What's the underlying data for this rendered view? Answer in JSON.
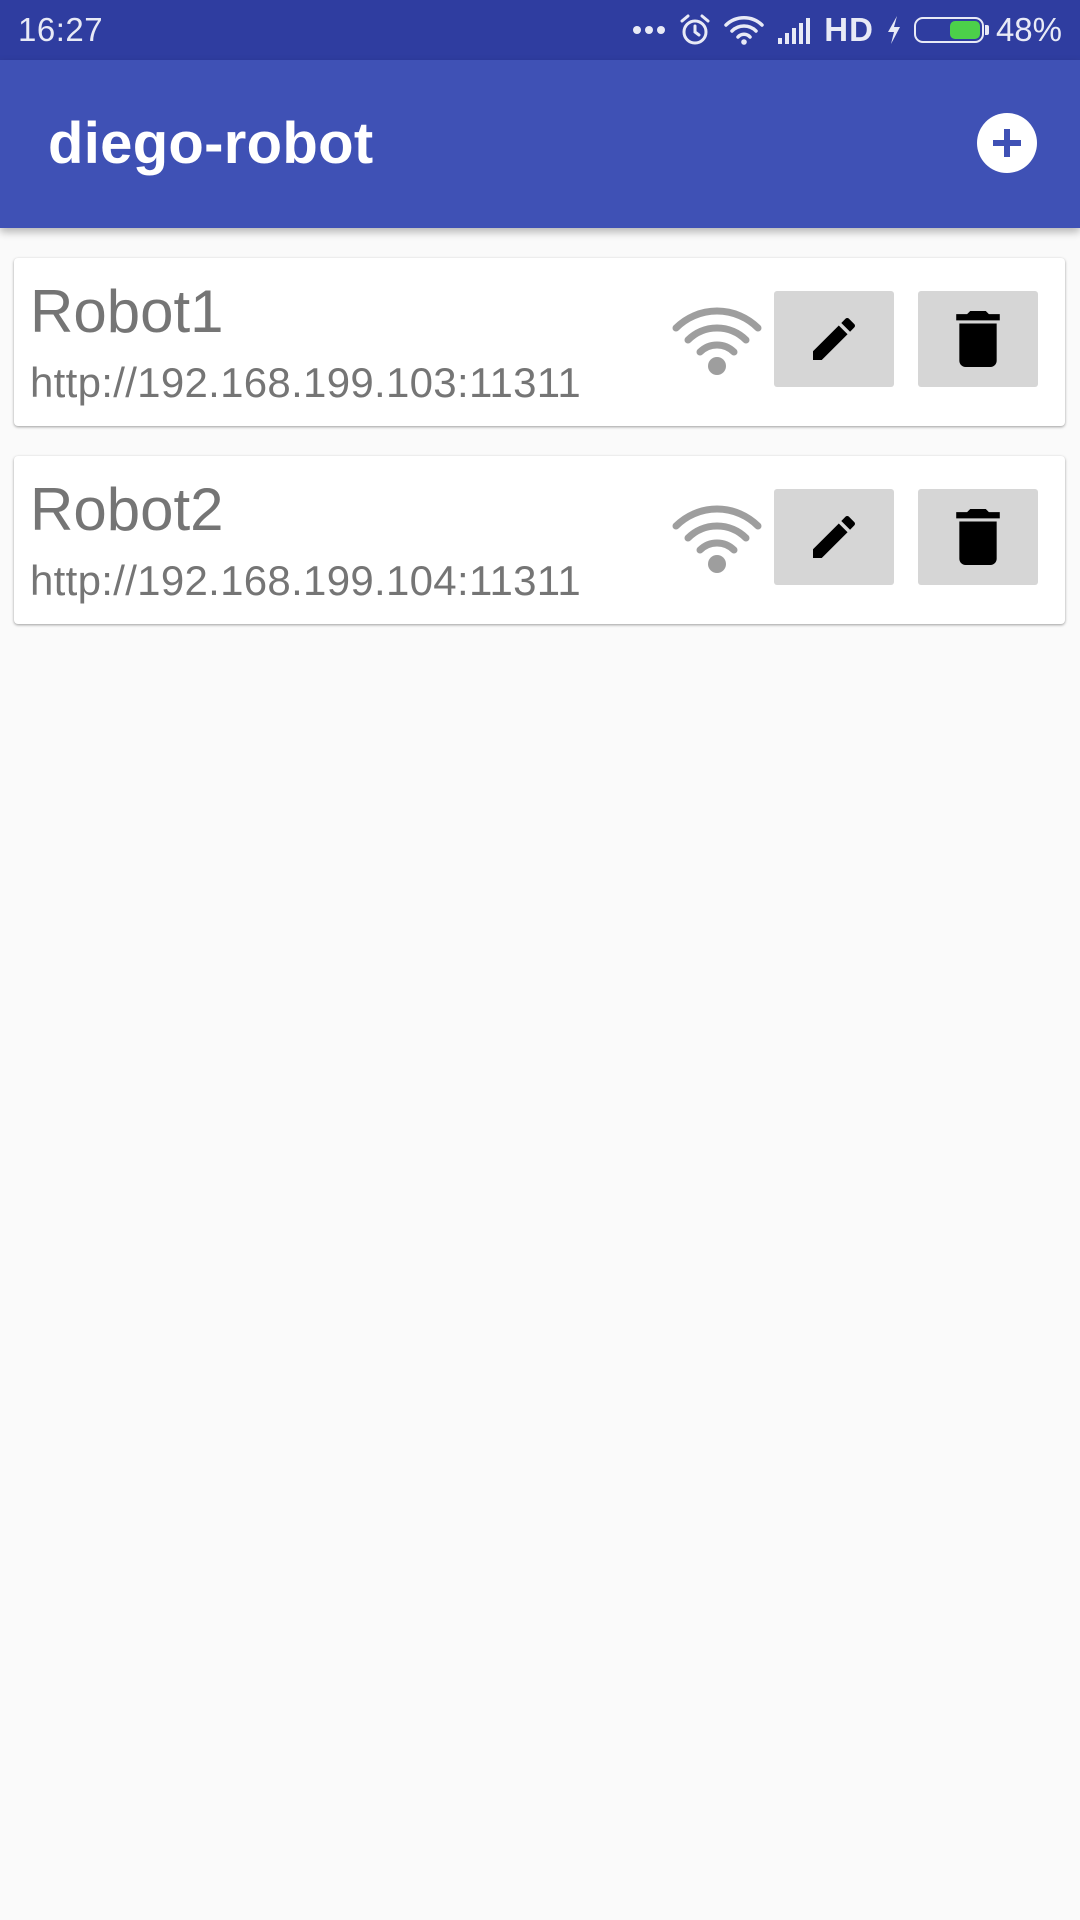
{
  "status_bar": {
    "time": "16:27",
    "network_type": "HD",
    "battery_percent_text": "48%",
    "battery_level": 0.48,
    "battery_color": "#4cd04a",
    "icons": [
      "more-dots-icon",
      "alarm-icon",
      "wifi-icon",
      "signal-icon",
      "charging-icon",
      "battery-icon"
    ]
  },
  "app_bar": {
    "title": "diego-robot",
    "add_icon": "add-circle-icon",
    "background": "#3f51b5"
  },
  "robots": [
    {
      "name": "Robot1",
      "url": "http://192.168.199.103:11311",
      "connection_icon": "wifi-icon",
      "edit_icon": "pencil-icon",
      "delete_icon": "trash-icon"
    },
    {
      "name": "Robot2",
      "url": "http://192.168.199.104:11311",
      "connection_icon": "wifi-icon",
      "edit_icon": "pencil-icon",
      "delete_icon": "trash-icon"
    }
  ]
}
